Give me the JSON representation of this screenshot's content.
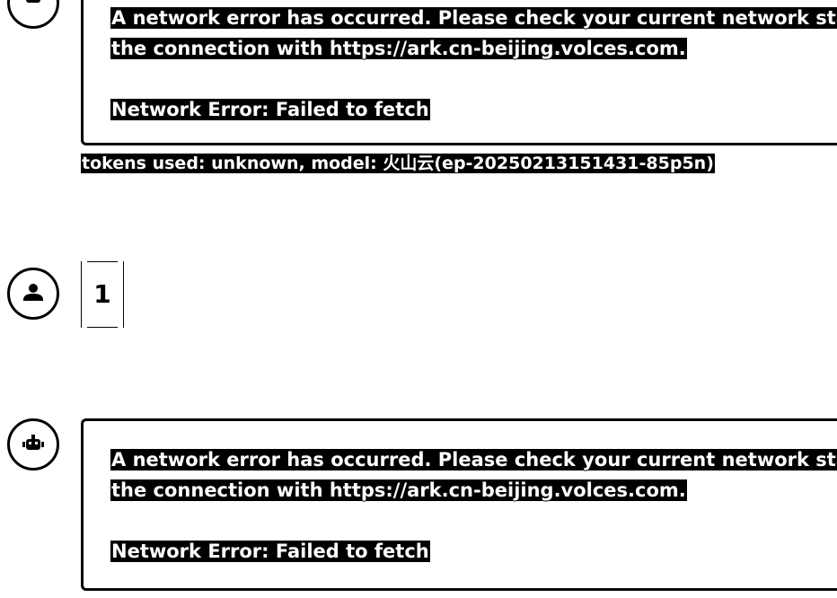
{
  "messages": [
    {
      "role": "assistant",
      "error_line1": "A network error has occurred. Please check your current network status a",
      "error_line2": "the connection with https://ark.cn-beijing.volces.com.",
      "error_detail": "Network Error: Failed to fetch",
      "meta": "tokens used: unknown, model: 火山云(ep-20250213151431-85p5n)"
    },
    {
      "role": "user",
      "text": "1"
    },
    {
      "role": "assistant",
      "error_line1": "A network error has occurred. Please check your current network status a",
      "error_line2": "the connection with https://ark.cn-beijing.volces.com.",
      "error_detail": "Network Error: Failed to fetch"
    }
  ]
}
